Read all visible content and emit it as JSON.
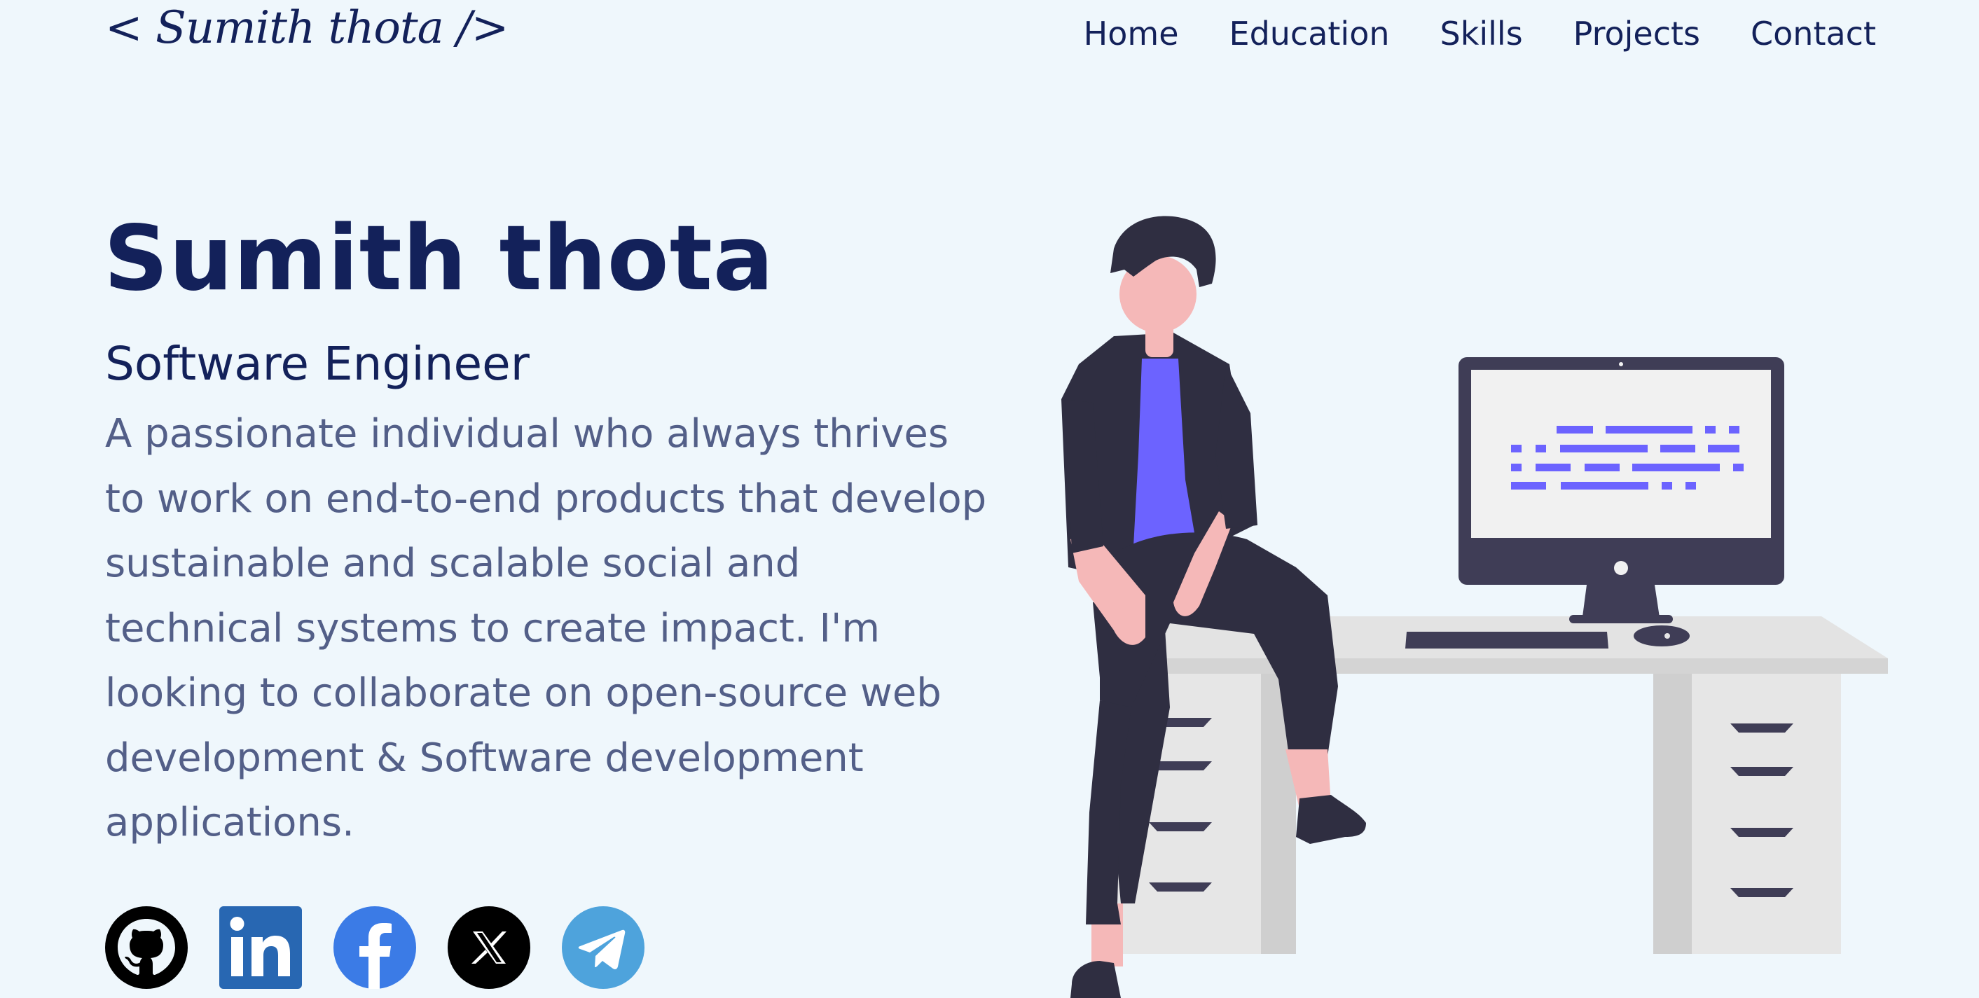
{
  "header": {
    "logo_text": "< Sumith thota />",
    "nav": [
      {
        "label": "Home"
      },
      {
        "label": "Education"
      },
      {
        "label": "Skills"
      },
      {
        "label": "Projects"
      },
      {
        "label": "Contact"
      }
    ]
  },
  "hero": {
    "name": "Sumith thota",
    "role": "Software Engineer",
    "bio": "A passionate individual who always thrives to work on end-to-end products that develop sustainable and scalable social and technical systems to create impact. I'm looking to collaborate on open-source web development & Software development applications."
  },
  "socials": [
    {
      "icon": "github-icon",
      "color": "#000000"
    },
    {
      "icon": "linkedin-icon",
      "color": "#2867b2"
    },
    {
      "icon": "facebook-icon",
      "color": "#3b7be6"
    },
    {
      "icon": "x-icon",
      "color": "#000000"
    },
    {
      "icon": "telegram-icon",
      "color": "#4ea3dc"
    }
  ],
  "colors": {
    "background": "#eff7fc",
    "primary_text": "#13215a",
    "secondary_text": "#535f88",
    "accent": "#6c63ff"
  }
}
